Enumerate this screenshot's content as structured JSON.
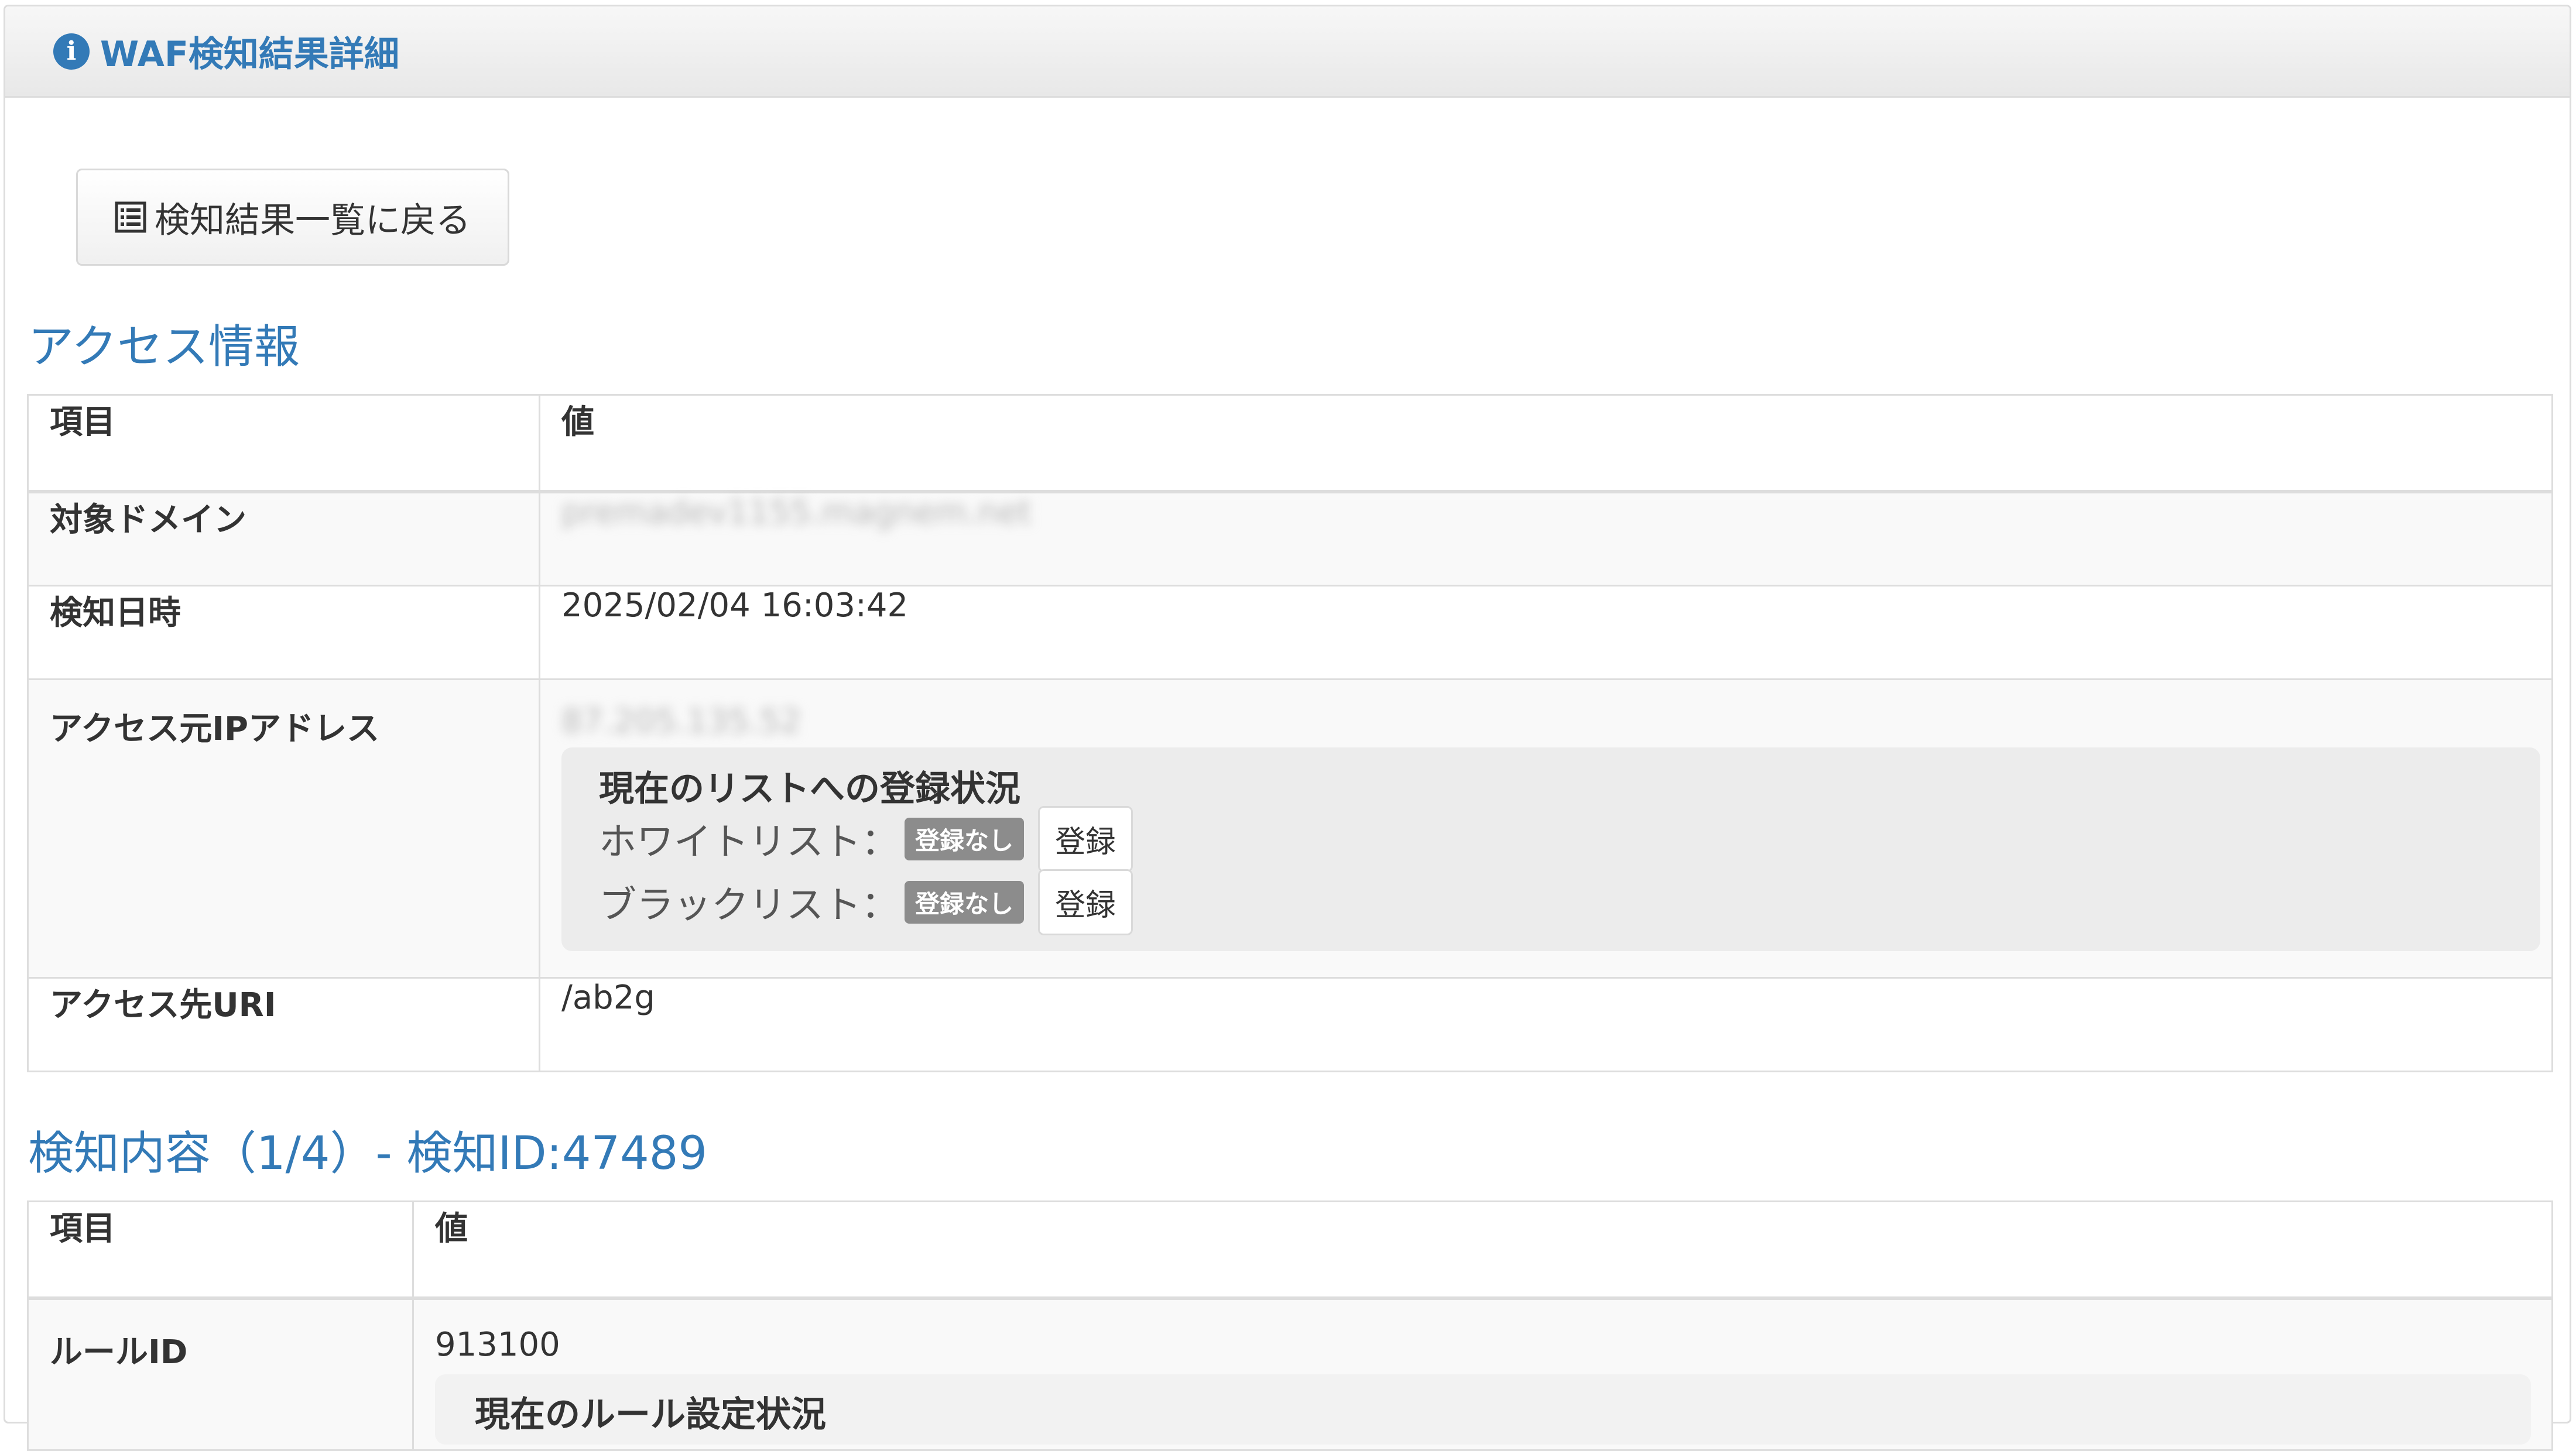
{
  "header": {
    "title": "WAF検知結果詳細",
    "info_icon": "i"
  },
  "back_button": {
    "label": "検知結果一覧に戻る",
    "icon": "list-icon"
  },
  "access_section": {
    "title": "アクセス情報",
    "columns": [
      "項目",
      "値"
    ],
    "rows": {
      "domain": {
        "key": "対象ドメイン",
        "value": "premadev1155.magnem.net"
      },
      "detected_at": {
        "key": "検知日時",
        "value": "2025/02/04 16:03:42"
      },
      "source_ip": {
        "key": "アクセス元IPアドレス",
        "value": "87.205.135.52"
      },
      "uri": {
        "key": "アクセス先URI",
        "value": "/ab2g"
      }
    },
    "registration": {
      "title": "現在のリストへの登録状況",
      "whitelist": {
        "label": "ホワイトリスト：",
        "status": "登録なし",
        "button": "登録"
      },
      "blacklist": {
        "label": "ブラックリスト：",
        "status": "登録なし",
        "button": "登録"
      }
    }
  },
  "detection_section": {
    "title": "検知内容（1/4）- 検知ID:47489",
    "columns": [
      "項目",
      "値"
    ],
    "rule": {
      "key": "ルールID",
      "value": "913100",
      "settings_title": "現在のルール設定状況"
    }
  }
}
